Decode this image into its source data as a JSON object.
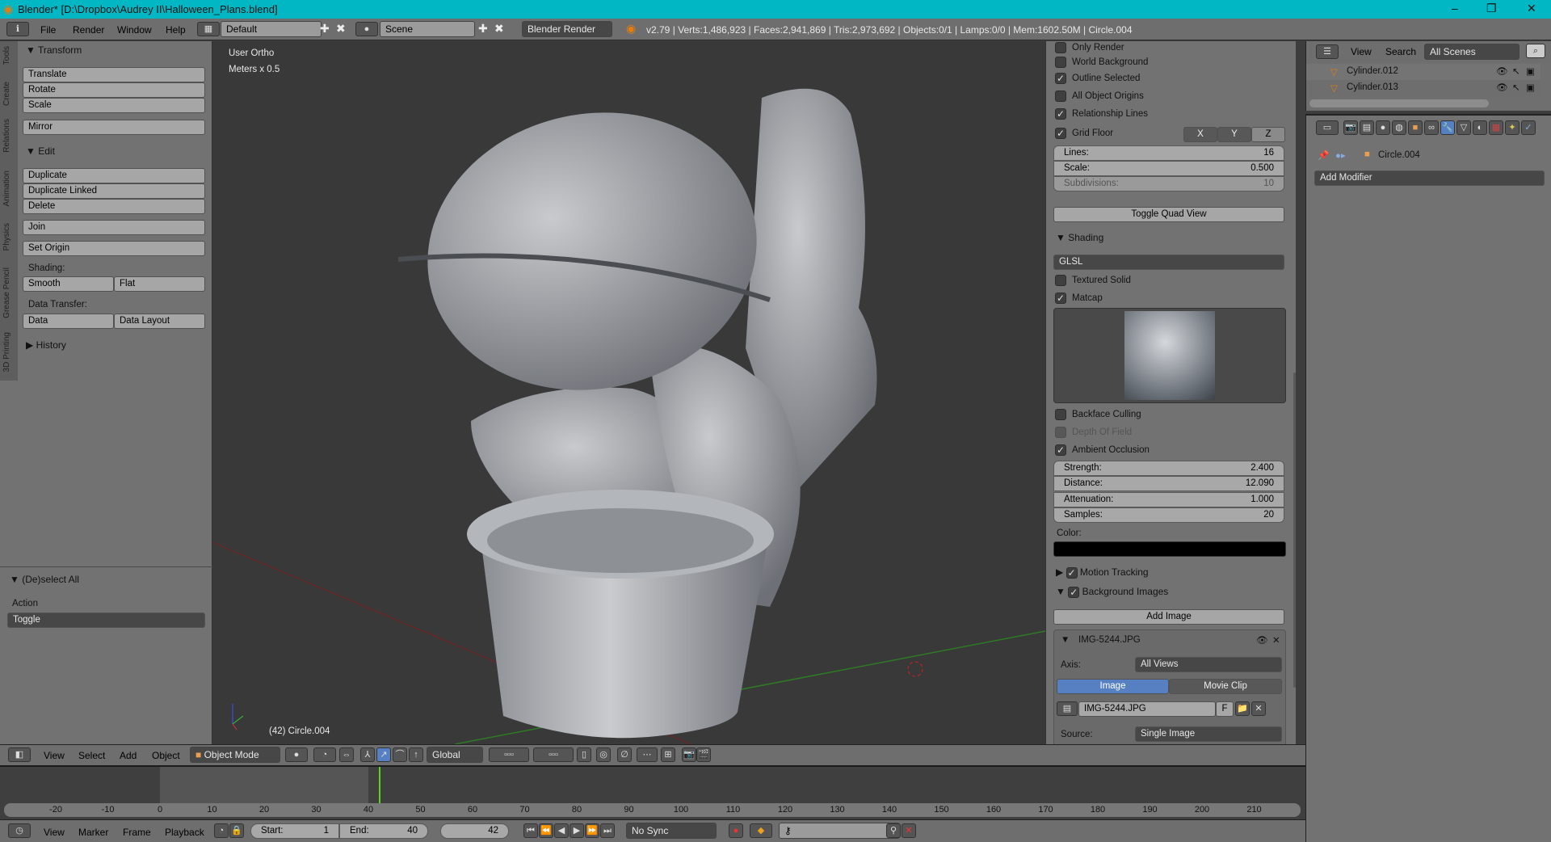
{
  "window": {
    "title": "Blender* [D:\\Dropbox\\Audrey II\\Halloween_Plans.blend]",
    "controls": [
      "–",
      "❐",
      "✕"
    ]
  },
  "topbar": {
    "menus": [
      "File",
      "Render",
      "Window",
      "Help"
    ],
    "layout": "Default",
    "scene": "Scene",
    "engine": "Blender Render",
    "stats": "v2.79 | Verts:1,486,923 | Faces:2,941,869 | Tris:2,973,692 | Objects:0/1 | Lamps:0/0 | Mem:1602.50M | Circle.004"
  },
  "toolshelf": {
    "tabs": [
      "Tools",
      "Create",
      "Relations",
      "Animation",
      "Physics",
      "Grease Pencil",
      "3D Printing"
    ],
    "transform": {
      "title": "Transform",
      "buttons": [
        "Translate",
        "Rotate",
        "Scale",
        "Mirror"
      ]
    },
    "edit": {
      "title": "Edit",
      "buttons": [
        "Duplicate",
        "Duplicate Linked",
        "Delete",
        "Join"
      ],
      "set_origin": "Set Origin",
      "shading_label": "Shading:",
      "smooth": "Smooth",
      "flat": "Flat",
      "data_transfer_label": "Data Transfer:",
      "data": "Data",
      "data_layout": "Data Layout"
    },
    "history": "History",
    "operator": {
      "title": "(De)select All",
      "action_label": "Action",
      "action_value": "Toggle"
    }
  },
  "viewport": {
    "view_name": "User Ortho",
    "units": "Meters x 0.5",
    "object_info": "(42) Circle.004"
  },
  "npanel": {
    "display": [
      {
        "label": "Only Render",
        "checked": false
      },
      {
        "label": "World Background",
        "checked": false
      },
      {
        "label": "Outline Selected",
        "checked": true
      },
      {
        "label": "All Object Origins",
        "checked": false
      },
      {
        "label": "Relationship Lines",
        "checked": true
      },
      {
        "label": "Grid Floor",
        "checked": true
      }
    ],
    "axes": [
      "X",
      "Y",
      "Z"
    ],
    "grid": [
      {
        "label": "Lines:",
        "value": "16"
      },
      {
        "label": "Scale:",
        "value": "0.500"
      },
      {
        "label": "Subdivisions:",
        "value": "10"
      }
    ],
    "toggle_quad": "Toggle Quad View",
    "shading": {
      "title": "Shading",
      "mode": "GLSL",
      "textured_solid": {
        "label": "Textured Solid",
        "checked": false
      },
      "matcap": {
        "label": "Matcap",
        "checked": true
      },
      "backface": {
        "label": "Backface Culling",
        "checked": false
      },
      "dof": {
        "label": "Depth Of Field",
        "checked": false
      },
      "ao": {
        "label": "Ambient Occlusion",
        "checked": true
      },
      "ao_fields": [
        {
          "label": "Strength:",
          "value": "2.400"
        },
        {
          "label": "Distance:",
          "value": "12.090"
        },
        {
          "label": "Attenuation:",
          "value": "1.000"
        },
        {
          "label": "Samples:",
          "value": "20"
        }
      ],
      "color_label": "Color:",
      "color": "#000000"
    },
    "motion_tracking": "Motion Tracking",
    "background_images": "Background Images",
    "add_image": "Add Image",
    "image": {
      "name": "IMG-5244.JPG",
      "axis_label": "Axis:",
      "axis": "All Views",
      "tabs": [
        "Image",
        "Movie Clip"
      ],
      "file": "IMG-5244.JPG",
      "f": "F",
      "source_label": "Source:",
      "source": "Single Image"
    }
  },
  "outliner": {
    "menus": [
      "View",
      "Search"
    ],
    "filter": "All Scenes",
    "items": [
      "Cylinder.012",
      "Cylinder.013"
    ]
  },
  "properties": {
    "object": "Circle.004",
    "add_modifier": "Add Modifier"
  },
  "header3d": {
    "menus": [
      "View",
      "Select",
      "Add",
      "Object"
    ],
    "mode": "Object Mode",
    "orientation": "Global"
  },
  "timeline": {
    "ticks": [
      "-20",
      "-10",
      "0",
      "10",
      "20",
      "30",
      "40",
      "50",
      "60",
      "70",
      "80",
      "90",
      "100",
      "110",
      "120",
      "130",
      "140",
      "150",
      "160",
      "170",
      "180",
      "190",
      "200",
      "210"
    ],
    "current_frame": 42,
    "range": [
      1,
      40
    ]
  },
  "tlheader": {
    "menus": [
      "View",
      "Marker",
      "Frame",
      "Playback"
    ],
    "start_label": "Start:",
    "start": "1",
    "end_label": "End:",
    "end": "40",
    "current": "42",
    "sync": "No Sync"
  },
  "colors": {
    "titlebar": "#00b7c3",
    "accent": "#5680c2",
    "frame_line": "#5fd21e"
  }
}
